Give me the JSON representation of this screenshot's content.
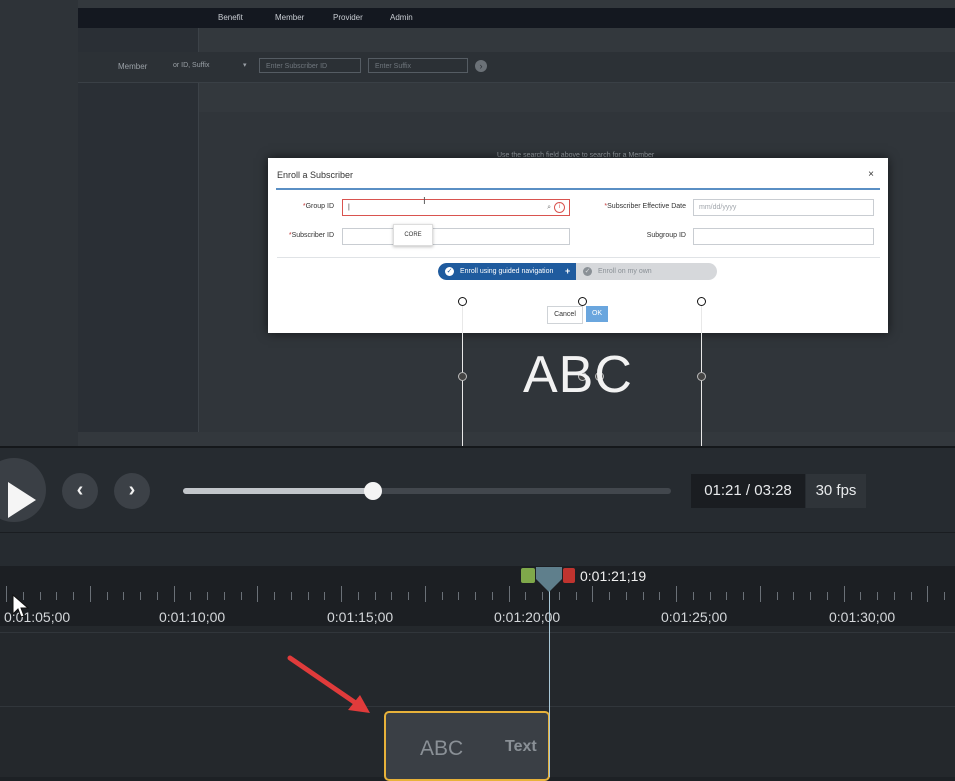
{
  "app": {
    "nav": [
      "Benefit",
      "Member",
      "Provider",
      "Admin"
    ],
    "search_label": "Member",
    "search_select": "or ID, Suffix",
    "subscriber_placeholder": "Enter Subscriber ID",
    "suffix_placeholder": "Enter Suffix",
    "hint": "Use the search field above to search for a Member"
  },
  "dialog": {
    "title": "Enroll a Subscriber",
    "close": "×",
    "group_id_label": "Group ID",
    "subscriber_id_label": "Subscriber ID",
    "effective_date_label": "Subscriber Effective Date",
    "effective_date_placeholder": "mm/dd/yyyy",
    "subgroup_id_label": "Subgroup ID",
    "group_cursor": "|",
    "suggestion": "CORE",
    "required_mark": "*",
    "guided": "Enroll using guided navigation",
    "guided_plus": "+",
    "own": "Enroll on my own",
    "cancel": "Cancel",
    "ok": "OK"
  },
  "canvas": {
    "text": "ABC"
  },
  "player": {
    "time": "01:21 / 03:28",
    "fps": "30 fps",
    "progress": 0.39
  },
  "timeline": {
    "playhead_time": "0:01:21;19",
    "labels": [
      "0:01:05;00",
      "0:01:10;00",
      "0:01:15;00",
      "0:01:20;00",
      "0:01:25;00",
      "0:01:30;00"
    ],
    "clip_main": "ABC",
    "clip_label": "Text"
  },
  "colors": {
    "accent_blue": "#1f5b9e",
    "clip_border": "#e8b23a",
    "annotation_arrow": "#e03b3b",
    "playhead_green": "#7fa84a",
    "playhead_red": "#c0342f"
  }
}
